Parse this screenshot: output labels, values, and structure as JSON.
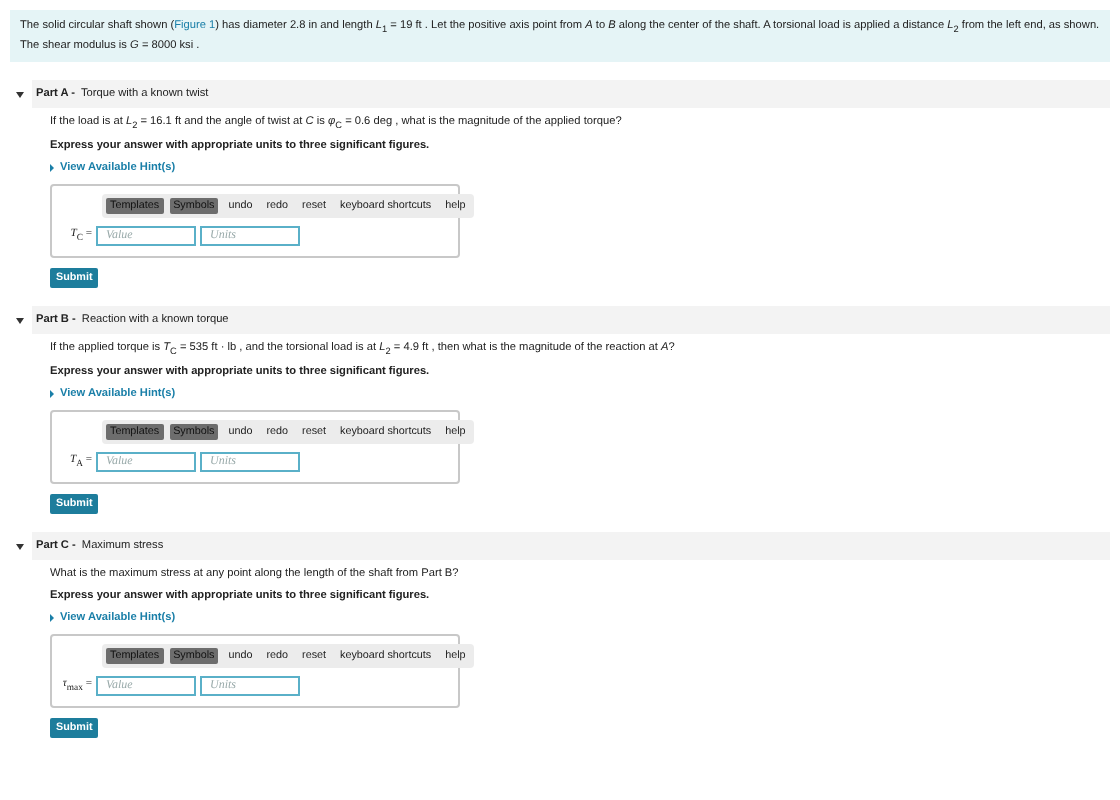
{
  "intro": {
    "text_before": "The solid circular shaft shown (",
    "link": "Figure 1",
    "text_after": ") has diameter 2.8 in and length *L*$_{1}$ = 19 ft . Let the positive axis point from *A* to *B* along the center of the shaft. A torsional load is applied a distance *L*$_{2}$  from the left end, as shown. The shear modulus is *G* = 8000 ksi ."
  },
  "parts": [
    {
      "label": "Part A -",
      "title": "Torque with a known twist",
      "expanded": true,
      "question": "If the load is at *L*$_{2}$ = 16.1 ft and the angle of twist at *C* is *φ*$_{C}$ = 0.6 deg , what is the magnitude of the applied torque?",
      "instruction": "Express your answer with appropriate units to three significant figures.",
      "hint_link": "View Available Hint(s)",
      "toolbar": [
        {
          "kind": "menu",
          "label": "Templates"
        },
        {
          "kind": "menu",
          "label": "Symbols"
        },
        {
          "kind": "action",
          "label": "undo"
        },
        {
          "kind": "action",
          "label": "redo"
        },
        {
          "kind": "action",
          "label": "reset"
        },
        {
          "kind": "action",
          "label": "keyboard shortcuts"
        },
        {
          "kind": "action",
          "label": "help"
        }
      ],
      "variable": "*T*$_{C}$ =",
      "value_placeholder": "Value",
      "units_placeholder": "Units",
      "submit": "Submit"
    },
    {
      "label": "Part B -",
      "title": "Reaction with a known torque",
      "expanded": true,
      "question": "If the applied torque is *T*$_{C}$ = 535 ft · lb , and the torsional load is at *L*$_{2}$ = 4.9 ft , then what is the magnitude of the reaction at *A*?",
      "instruction": "Express your answer with appropriate units to three significant figures.",
      "hint_link": "View Available Hint(s)",
      "toolbar": [
        {
          "kind": "menu",
          "label": "Templates"
        },
        {
          "kind": "menu",
          "label": "Symbols"
        },
        {
          "kind": "action",
          "label": "undo"
        },
        {
          "kind": "action",
          "label": "redo"
        },
        {
          "kind": "action",
          "label": "reset"
        },
        {
          "kind": "action",
          "label": "keyboard shortcuts"
        },
        {
          "kind": "action",
          "label": "help"
        }
      ],
      "variable": "*T*$_{A}$ =",
      "value_placeholder": "Value",
      "units_placeholder": "Units",
      "submit": "Submit"
    },
    {
      "label": "Part C -",
      "title": "Maximum stress",
      "expanded": true,
      "question": "What is the maximum stress at any point along the length of the shaft from Part B?",
      "instruction": "Express your answer with appropriate units to three significant figures.",
      "hint_link": "View Available Hint(s)",
      "toolbar": [
        {
          "kind": "menu",
          "label": "Templates"
        },
        {
          "kind": "menu",
          "label": "Symbols"
        },
        {
          "kind": "action",
          "label": "undo"
        },
        {
          "kind": "action",
          "label": "redo"
        },
        {
          "kind": "action",
          "label": "reset"
        },
        {
          "kind": "action",
          "label": "keyboard shortcuts"
        },
        {
          "kind": "action",
          "label": "help"
        }
      ],
      "variable": "*τ*$_{max}$ =",
      "value_placeholder": "Value",
      "units_placeholder": "Units",
      "submit": "Submit"
    }
  ]
}
